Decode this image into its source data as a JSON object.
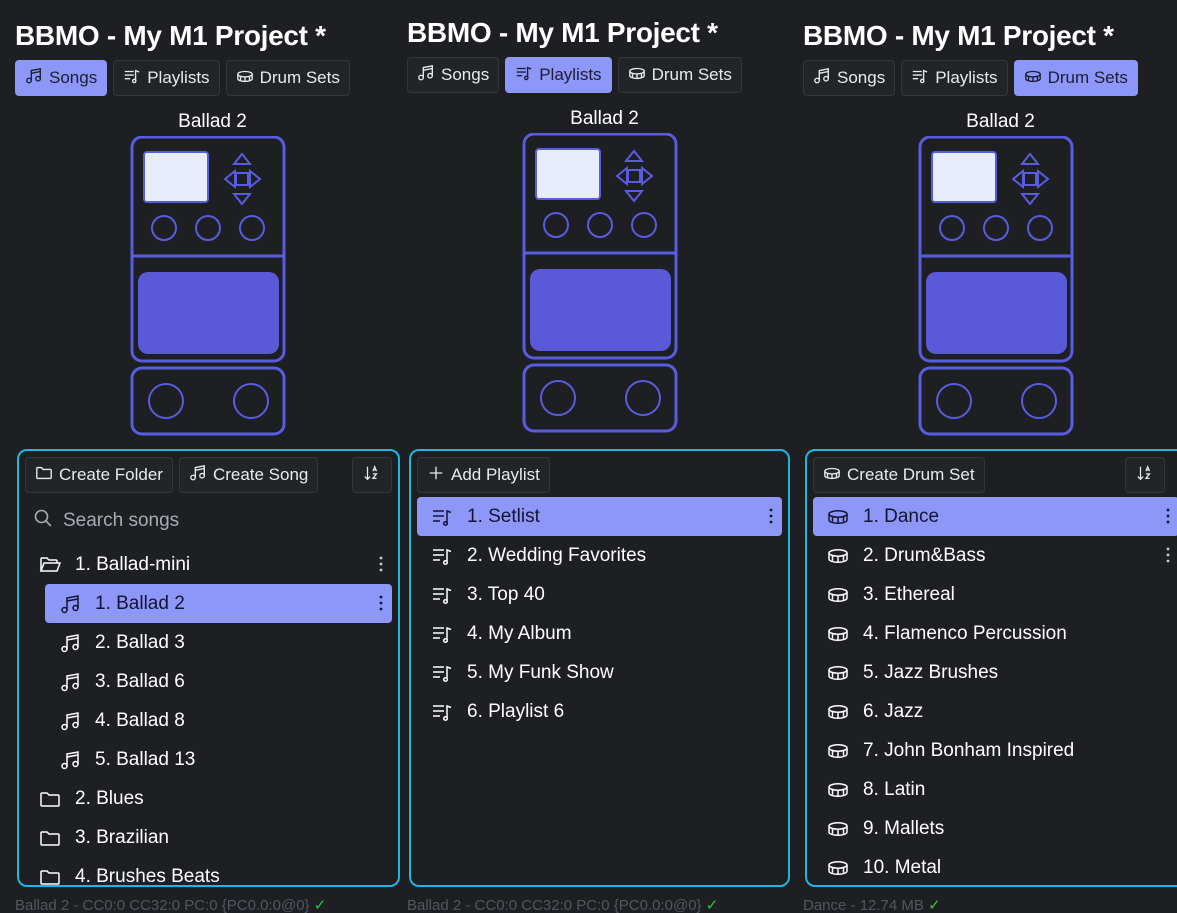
{
  "colors": {
    "background": "#1d1f23",
    "accent": "#8d97f7",
    "listbox_border": "#1fb7de",
    "device_stroke": "#5a5ce0",
    "device_fill": "#5a5ad8",
    "screen_fill": "#e8ecff",
    "status_ok": "#2ecc40"
  },
  "panels": [
    {
      "title": "BBMO - My M1 Project *",
      "tabs": [
        {
          "label": "Songs",
          "icon": "music-note-icon",
          "active": true
        },
        {
          "label": "Playlists",
          "icon": "playlist-icon",
          "active": false
        },
        {
          "label": "Drum Sets",
          "icon": "drum-icon",
          "active": false
        }
      ],
      "device_name": "Ballad 2",
      "toolbar": {
        "create_folder": "Create Folder",
        "create_song": "Create Song"
      },
      "search_placeholder": "Search songs",
      "items": [
        {
          "label": "1. Ballad-mini",
          "icon": "folder-open-icon",
          "indent": 0,
          "selected": false,
          "menu": true
        },
        {
          "label": "1. Ballad 2",
          "icon": "music-note-icon",
          "indent": 1,
          "selected": true,
          "menu": true
        },
        {
          "label": "2. Ballad 3",
          "icon": "music-note-icon",
          "indent": 1,
          "selected": false,
          "menu": false
        },
        {
          "label": "3. Ballad 6",
          "icon": "music-note-icon",
          "indent": 1,
          "selected": false,
          "menu": false
        },
        {
          "label": "4. Ballad 8",
          "icon": "music-note-icon",
          "indent": 1,
          "selected": false,
          "menu": false
        },
        {
          "label": "5. Ballad 13",
          "icon": "music-note-icon",
          "indent": 1,
          "selected": false,
          "menu": false
        },
        {
          "label": "2. Blues",
          "icon": "folder-icon",
          "indent": 0,
          "selected": false,
          "menu": false
        },
        {
          "label": "3. Brazilian",
          "icon": "folder-icon",
          "indent": 0,
          "selected": false,
          "menu": false
        },
        {
          "label": "4. Brushes Beats",
          "icon": "folder-icon",
          "indent": 0,
          "selected": false,
          "menu": false
        }
      ],
      "status": {
        "text": "Ballad 2 - CC0:0 CC32:0 PC:0 {PC0.0:0@0}",
        "check": "✓"
      }
    },
    {
      "title": "BBMO - My M1 Project *",
      "tabs": [
        {
          "label": "Songs",
          "icon": "music-note-icon",
          "active": false
        },
        {
          "label": "Playlists",
          "icon": "playlist-icon",
          "active": true
        },
        {
          "label": "Drum Sets",
          "icon": "drum-icon",
          "active": false
        }
      ],
      "device_name": "Ballad 2",
      "toolbar": {
        "add_playlist": "Add Playlist"
      },
      "items": [
        {
          "label": "1. Setlist",
          "icon": "playlist-icon",
          "selected": true,
          "menu": true
        },
        {
          "label": "2. Wedding Favorites",
          "icon": "playlist-icon",
          "selected": false,
          "menu": false
        },
        {
          "label": "3. Top 40",
          "icon": "playlist-icon",
          "selected": false,
          "menu": false
        },
        {
          "label": "4. My Album",
          "icon": "playlist-icon",
          "selected": false,
          "menu": false
        },
        {
          "label": "5. My Funk Show",
          "icon": "playlist-icon",
          "selected": false,
          "menu": false
        },
        {
          "label": "6. Playlist 6",
          "icon": "playlist-icon",
          "selected": false,
          "menu": false
        }
      ],
      "status": {
        "text": "Ballad 2 - CC0:0 CC32:0 PC:0 {PC0.0:0@0}",
        "check": "✓"
      }
    },
    {
      "title": "BBMO - My M1 Project *",
      "tabs": [
        {
          "label": "Songs",
          "icon": "music-note-icon",
          "active": false
        },
        {
          "label": "Playlists",
          "icon": "playlist-icon",
          "active": false
        },
        {
          "label": "Drum Sets",
          "icon": "drum-icon",
          "active": true
        }
      ],
      "device_name": "Ballad 2",
      "toolbar": {
        "create_drum_set": "Create Drum Set"
      },
      "items": [
        {
          "label": "1. Dance",
          "icon": "drum-icon",
          "selected": true,
          "menu": true
        },
        {
          "label": "2. Drum&Bass",
          "icon": "drum-icon",
          "selected": false,
          "menu": true
        },
        {
          "label": "3. Ethereal",
          "icon": "drum-icon",
          "selected": false,
          "menu": false
        },
        {
          "label": "4. Flamenco Percussion",
          "icon": "drum-icon",
          "selected": false,
          "menu": false
        },
        {
          "label": "5. Jazz Brushes",
          "icon": "drum-icon",
          "selected": false,
          "menu": false
        },
        {
          "label": "6. Jazz",
          "icon": "drum-icon",
          "selected": false,
          "menu": false
        },
        {
          "label": "7. John Bonham Inspired",
          "icon": "drum-icon",
          "selected": false,
          "menu": false
        },
        {
          "label": "8. Latin",
          "icon": "drum-icon",
          "selected": false,
          "menu": false
        },
        {
          "label": "9. Mallets",
          "icon": "drum-icon",
          "selected": false,
          "menu": false
        },
        {
          "label": "10. Metal",
          "icon": "drum-icon",
          "selected": false,
          "menu": false
        }
      ],
      "status": {
        "text": "Dance - 12.74 MB",
        "check": "✓"
      }
    }
  ]
}
